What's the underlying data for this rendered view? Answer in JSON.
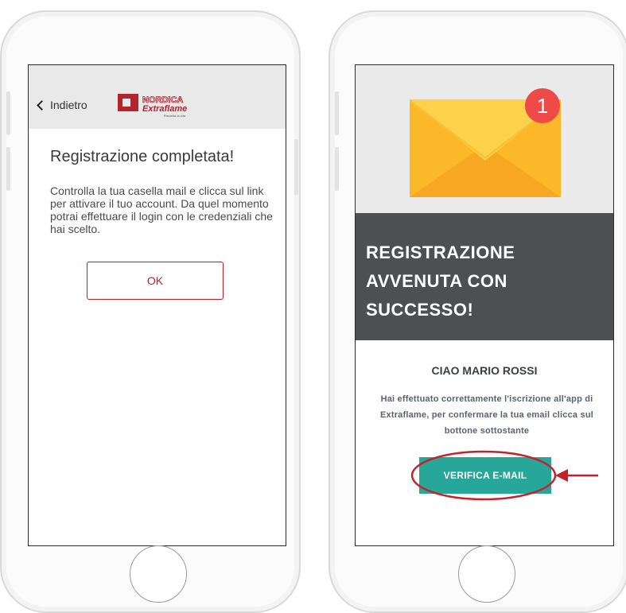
{
  "left_phone": {
    "header": {
      "back_label": "Indietro"
    },
    "logo": {
      "brand_top": "NORDICA",
      "brand_bottom": "Extraflame",
      "tagline": "Riscalda la vita."
    },
    "title": "Registrazione completata!",
    "body": "Controlla la tua casella mail e clicca sul link per attivare il tuo account. Da quel momento potrai effettuare il login con le credenziali che hai scelto.",
    "ok_button": "OK"
  },
  "right_phone": {
    "badge_count": "1",
    "banner_title": "REGISTRAZIONE AVVENUTA CON SUCCESSO!",
    "greeting": "CIAO MARIO ROSSI",
    "message": "Hai effettuato correttamente l'iscrizione all'app di Extraflame, per confermare la tua email clicca sul bottone sottostante",
    "verify_button": "VERIFICA E-MAIL"
  },
  "colors": {
    "brand_red": "#b5232c",
    "banner_gray": "#4d4f50",
    "verify_teal": "#26a79a",
    "badge_red": "#ee4a48",
    "envelope_yellow": "#f9c531",
    "annotation_red": "#c4212b"
  },
  "icons": [
    "chevron-left-icon",
    "envelope-icon",
    "notification-badge-icon",
    "arrow-left-icon",
    "home-button-icon"
  ]
}
